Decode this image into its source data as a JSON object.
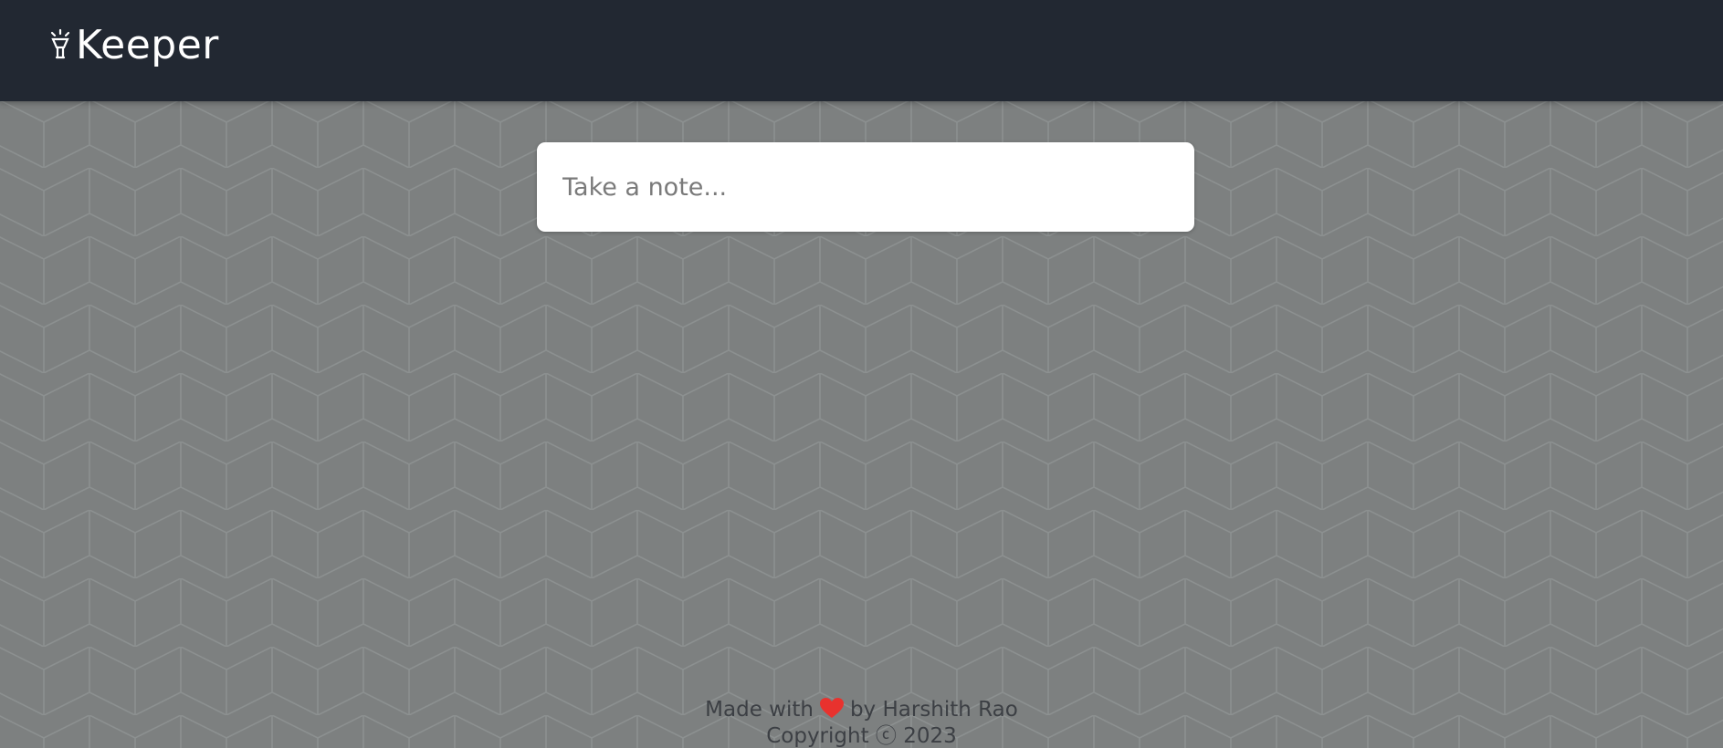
{
  "header": {
    "logo_text": "Keeper",
    "logo_icon": "lamp-icon",
    "background": "#222832"
  },
  "note": {
    "placeholder": "Take a note..."
  },
  "footer": {
    "made_with": "Made with",
    "heart_icon": "heart-icon",
    "heart_color": "#e8322e",
    "by_author": "by Harshith Rao",
    "copyright": "Copyright ⓒ 2023"
  },
  "page": {
    "background": "#7d8080"
  }
}
